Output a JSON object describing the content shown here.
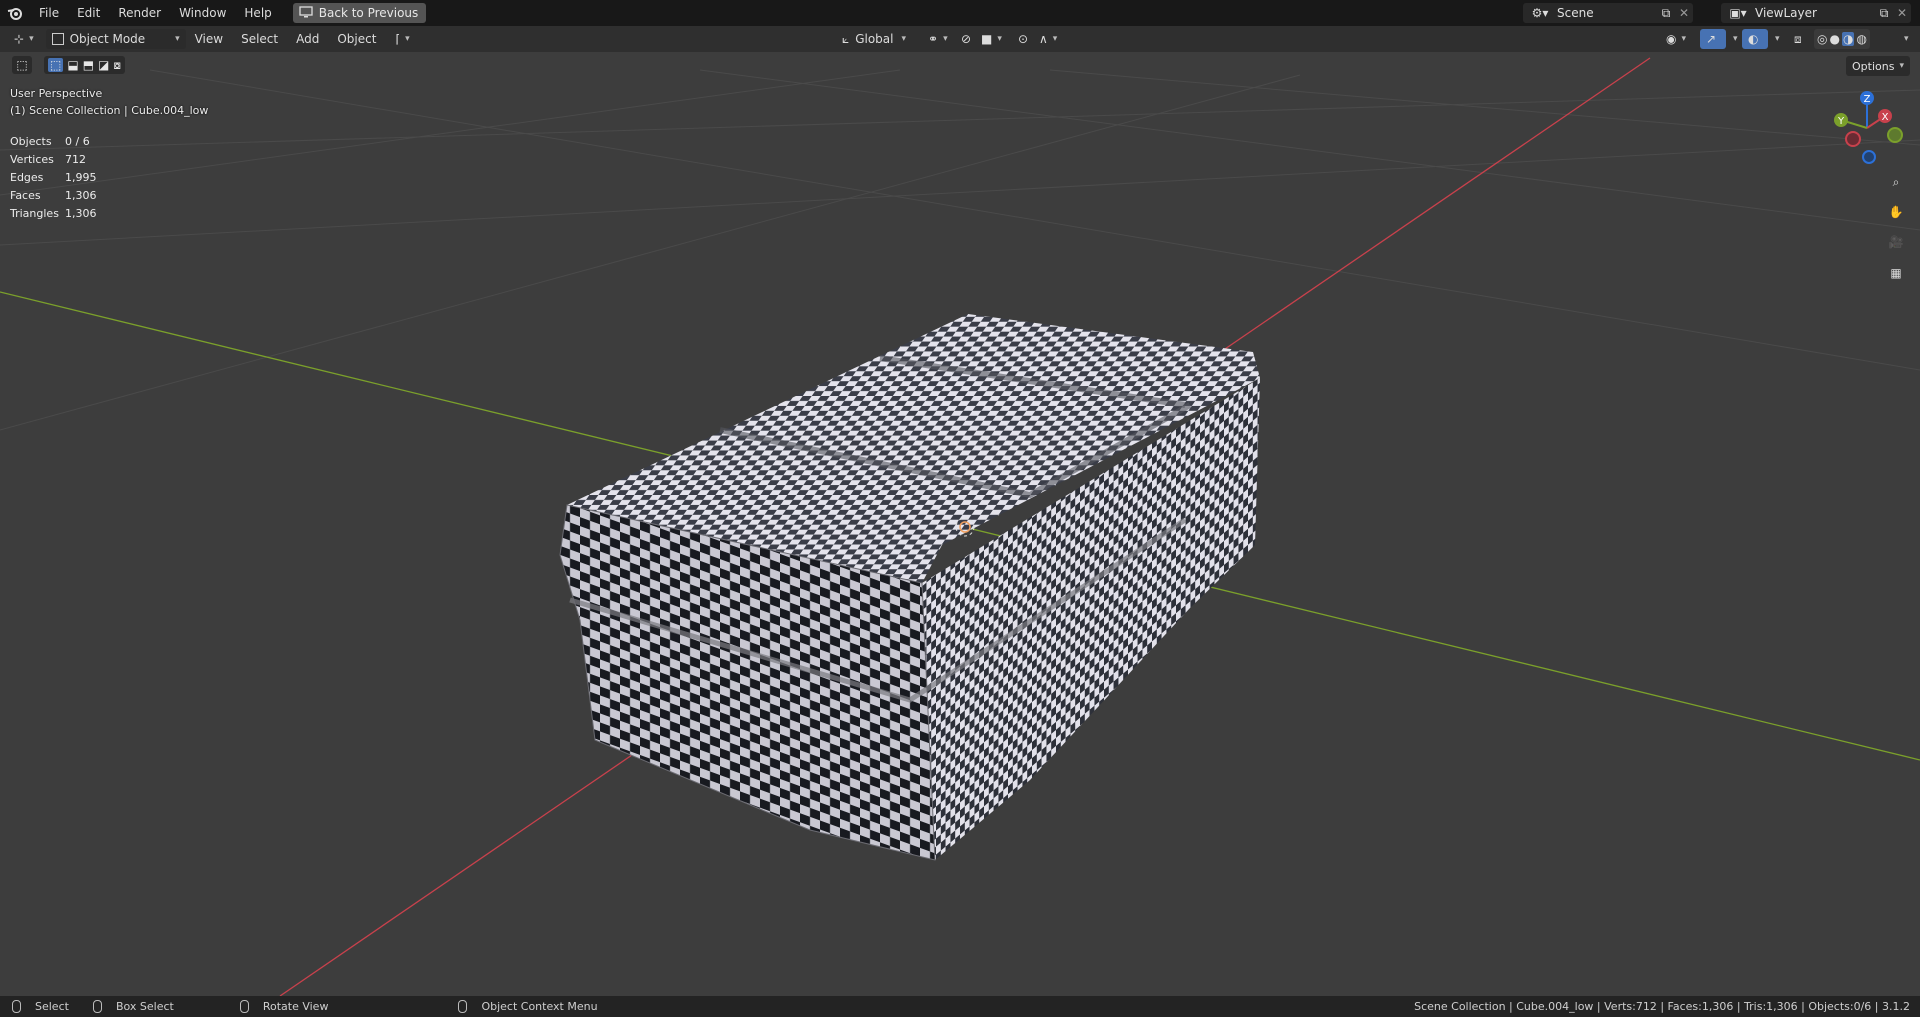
{
  "menubar": {
    "items": [
      "File",
      "Edit",
      "Render",
      "Window",
      "Help"
    ],
    "back_button": "Back to Previous",
    "scene": "Scene",
    "view_layer": "ViewLayer"
  },
  "header": {
    "mode": "Object Mode",
    "menus": [
      "View",
      "Select",
      "Add",
      "Object"
    ],
    "transform_orientation": "Global",
    "options": "Options"
  },
  "viewport": {
    "perspective": "User Perspective",
    "collection": "(1) Scene Collection | Cube.004_low",
    "stats": [
      {
        "label": "Objects",
        "value": "0 / 6"
      },
      {
        "label": "Vertices",
        "value": "712"
      },
      {
        "label": "Edges",
        "value": "1,995"
      },
      {
        "label": "Faces",
        "value": "1,306"
      },
      {
        "label": "Triangles",
        "value": "1,306"
      }
    ],
    "gizmo_axes": [
      "X",
      "Y",
      "Z"
    ]
  },
  "statusbar": {
    "select": "Select",
    "box_select": "Box Select",
    "rotate_view": "Rotate View",
    "context_menu": "Object Context Menu",
    "info": "Scene Collection | Cube.004_low | Verts:712 | Faces:1,306 | Tris:1,306 | Objects:0/6 | 3.1.2"
  },
  "colors": {
    "x_axis": "#c8414c",
    "y_axis": "#7ba02b",
    "z_axis": "#2c70d8",
    "accent": "#4772b3"
  }
}
